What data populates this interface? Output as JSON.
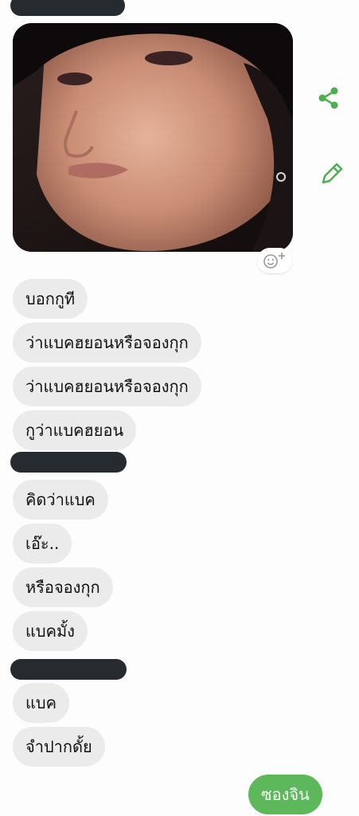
{
  "colors": {
    "incoming_bubble": "#ebebeb",
    "outgoing_bubble": "#5cb85a",
    "icon_green": "#4caf50",
    "redaction": "#262b30"
  },
  "icons": {
    "share": "share-icon",
    "edit": "pencil-icon",
    "reaction": "add-reaction-icon"
  },
  "messages_group1": [
    {
      "text": "บอกกูที"
    },
    {
      "text": "ว่าแบคฮยอนหรือจองกุก"
    },
    {
      "text": "ว่าแบคฮยอนหรือจองกุก"
    },
    {
      "text": "กูว่าแบคฮยอน"
    }
  ],
  "messages_group2": [
    {
      "text": "คิดว่าแบค"
    },
    {
      "text": "เอ๊ะ.."
    },
    {
      "text": "หรือจองกุก"
    },
    {
      "text": "แบคมั้ง"
    }
  ],
  "messages_group3": [
    {
      "text": "แบค"
    },
    {
      "text": "จำปากดั้ย"
    }
  ],
  "outgoing": {
    "text": "ซองจิน"
  }
}
